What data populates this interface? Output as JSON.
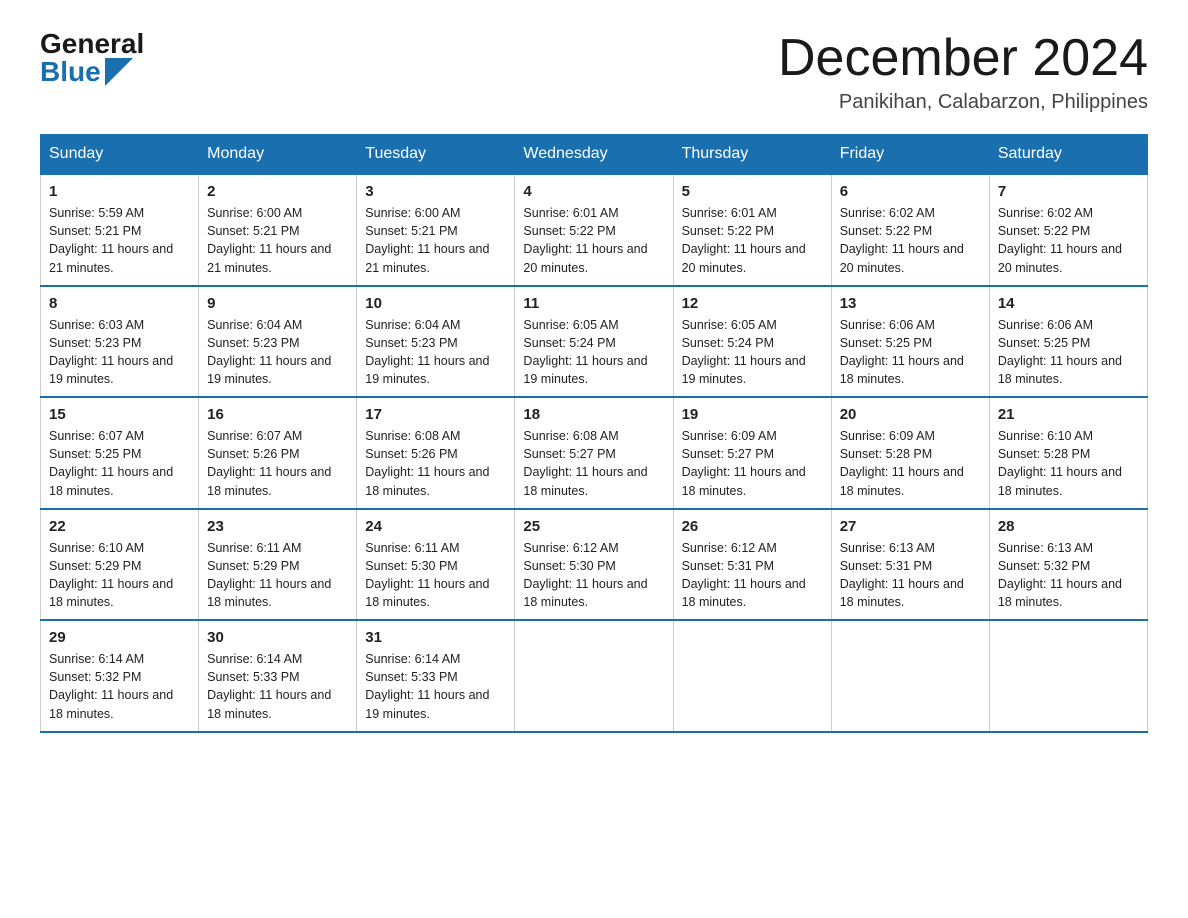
{
  "header": {
    "logo_general": "General",
    "logo_blue": "Blue",
    "month_title": "December 2024",
    "location": "Panikihan, Calabarzon, Philippines"
  },
  "days_of_week": [
    "Sunday",
    "Monday",
    "Tuesday",
    "Wednesday",
    "Thursday",
    "Friday",
    "Saturday"
  ],
  "weeks": [
    [
      {
        "day": "1",
        "sunrise": "5:59 AM",
        "sunset": "5:21 PM",
        "daylight": "11 hours and 21 minutes."
      },
      {
        "day": "2",
        "sunrise": "6:00 AM",
        "sunset": "5:21 PM",
        "daylight": "11 hours and 21 minutes."
      },
      {
        "day": "3",
        "sunrise": "6:00 AM",
        "sunset": "5:21 PM",
        "daylight": "11 hours and 21 minutes."
      },
      {
        "day": "4",
        "sunrise": "6:01 AM",
        "sunset": "5:22 PM",
        "daylight": "11 hours and 20 minutes."
      },
      {
        "day": "5",
        "sunrise": "6:01 AM",
        "sunset": "5:22 PM",
        "daylight": "11 hours and 20 minutes."
      },
      {
        "day": "6",
        "sunrise": "6:02 AM",
        "sunset": "5:22 PM",
        "daylight": "11 hours and 20 minutes."
      },
      {
        "day": "7",
        "sunrise": "6:02 AM",
        "sunset": "5:22 PM",
        "daylight": "11 hours and 20 minutes."
      }
    ],
    [
      {
        "day": "8",
        "sunrise": "6:03 AM",
        "sunset": "5:23 PM",
        "daylight": "11 hours and 19 minutes."
      },
      {
        "day": "9",
        "sunrise": "6:04 AM",
        "sunset": "5:23 PM",
        "daylight": "11 hours and 19 minutes."
      },
      {
        "day": "10",
        "sunrise": "6:04 AM",
        "sunset": "5:23 PM",
        "daylight": "11 hours and 19 minutes."
      },
      {
        "day": "11",
        "sunrise": "6:05 AM",
        "sunset": "5:24 PM",
        "daylight": "11 hours and 19 minutes."
      },
      {
        "day": "12",
        "sunrise": "6:05 AM",
        "sunset": "5:24 PM",
        "daylight": "11 hours and 19 minutes."
      },
      {
        "day": "13",
        "sunrise": "6:06 AM",
        "sunset": "5:25 PM",
        "daylight": "11 hours and 18 minutes."
      },
      {
        "day": "14",
        "sunrise": "6:06 AM",
        "sunset": "5:25 PM",
        "daylight": "11 hours and 18 minutes."
      }
    ],
    [
      {
        "day": "15",
        "sunrise": "6:07 AM",
        "sunset": "5:25 PM",
        "daylight": "11 hours and 18 minutes."
      },
      {
        "day": "16",
        "sunrise": "6:07 AM",
        "sunset": "5:26 PM",
        "daylight": "11 hours and 18 minutes."
      },
      {
        "day": "17",
        "sunrise": "6:08 AM",
        "sunset": "5:26 PM",
        "daylight": "11 hours and 18 minutes."
      },
      {
        "day": "18",
        "sunrise": "6:08 AM",
        "sunset": "5:27 PM",
        "daylight": "11 hours and 18 minutes."
      },
      {
        "day": "19",
        "sunrise": "6:09 AM",
        "sunset": "5:27 PM",
        "daylight": "11 hours and 18 minutes."
      },
      {
        "day": "20",
        "sunrise": "6:09 AM",
        "sunset": "5:28 PM",
        "daylight": "11 hours and 18 minutes."
      },
      {
        "day": "21",
        "sunrise": "6:10 AM",
        "sunset": "5:28 PM",
        "daylight": "11 hours and 18 minutes."
      }
    ],
    [
      {
        "day": "22",
        "sunrise": "6:10 AM",
        "sunset": "5:29 PM",
        "daylight": "11 hours and 18 minutes."
      },
      {
        "day": "23",
        "sunrise": "6:11 AM",
        "sunset": "5:29 PM",
        "daylight": "11 hours and 18 minutes."
      },
      {
        "day": "24",
        "sunrise": "6:11 AM",
        "sunset": "5:30 PM",
        "daylight": "11 hours and 18 minutes."
      },
      {
        "day": "25",
        "sunrise": "6:12 AM",
        "sunset": "5:30 PM",
        "daylight": "11 hours and 18 minutes."
      },
      {
        "day": "26",
        "sunrise": "6:12 AM",
        "sunset": "5:31 PM",
        "daylight": "11 hours and 18 minutes."
      },
      {
        "day": "27",
        "sunrise": "6:13 AM",
        "sunset": "5:31 PM",
        "daylight": "11 hours and 18 minutes."
      },
      {
        "day": "28",
        "sunrise": "6:13 AM",
        "sunset": "5:32 PM",
        "daylight": "11 hours and 18 minutes."
      }
    ],
    [
      {
        "day": "29",
        "sunrise": "6:14 AM",
        "sunset": "5:32 PM",
        "daylight": "11 hours and 18 minutes."
      },
      {
        "day": "30",
        "sunrise": "6:14 AM",
        "sunset": "5:33 PM",
        "daylight": "11 hours and 18 minutes."
      },
      {
        "day": "31",
        "sunrise": "6:14 AM",
        "sunset": "5:33 PM",
        "daylight": "11 hours and 19 minutes."
      },
      null,
      null,
      null,
      null
    ]
  ]
}
